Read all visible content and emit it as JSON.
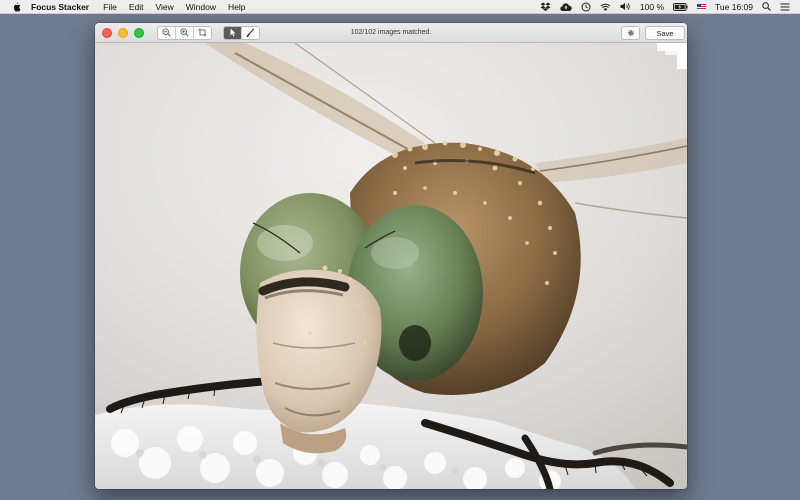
{
  "menubar": {
    "apple_icon": "apple-icon",
    "items": [
      "Focus Stacker",
      "File",
      "Edit",
      "View",
      "Window",
      "Help"
    ],
    "status": {
      "icons": [
        "dropbox-icon",
        "cloud-upload-icon",
        "time-machine-icon",
        "wifi-icon",
        "volume-icon",
        "battery-icon",
        "flag-icon",
        "search-icon",
        "list-icon"
      ],
      "battery_text": "100 %",
      "clock": "Tue 16:09"
    }
  },
  "window": {
    "toolbar": {
      "zoom_tools": [
        "zoom-out-icon",
        "zoom-in-icon",
        "crop-icon"
      ],
      "edit_tools": [
        "pointer-icon",
        "brush-icon"
      ],
      "active_tool": "pointer-icon",
      "status_text": "102/102 images matched.",
      "settings_icon": "gear-icon",
      "save_label": "Save"
    },
    "image": {
      "subject": "dragonfly-macro-photo",
      "background_color": "#e9e7e5",
      "eye_color": "#7e8f60"
    }
  }
}
